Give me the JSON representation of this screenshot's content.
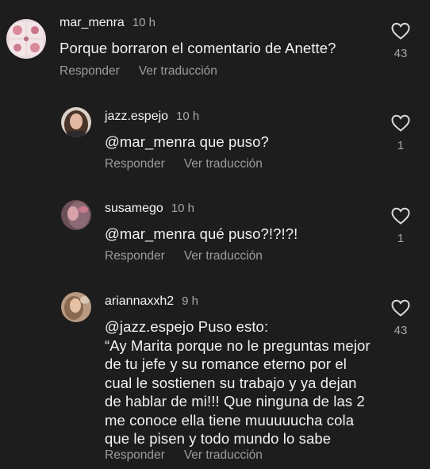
{
  "comments": [
    {
      "username": "mar_menra",
      "time": "10 h",
      "text": "Porque borraron el comentario de Anette?",
      "likes": "43",
      "reply_label": "Responder",
      "translate_label": "Ver traducción"
    },
    {
      "username": "jazz.espejo",
      "time": "10 h",
      "text": "@mar_menra que puso?",
      "likes": "1",
      "reply_label": "Responder",
      "translate_label": "Ver traducción"
    },
    {
      "username": "susamego",
      "time": "10 h",
      "text": "@mar_menra qué puso?!?!?!",
      "likes": "1",
      "reply_label": "Responder",
      "translate_label": "Ver traducción"
    },
    {
      "username": "ariannaxxh2",
      "time": "9 h",
      "text_lines": [
        "@jazz.espejo Puso esto:",
        "“Ay Marita porque no le preguntas mejor",
        "de tu jefe y su romance eterno por el",
        "cual le sostienen su trabajo y ya dejan",
        "de hablar de mi!!! Que ninguna de las 2",
        "me conoce ella tiene muuuuucha cola",
        "que le pisen y todo mundo lo sabe"
      ],
      "likes": "43",
      "reply_label": "Responder",
      "translate_label": "Ver traducción"
    }
  ]
}
